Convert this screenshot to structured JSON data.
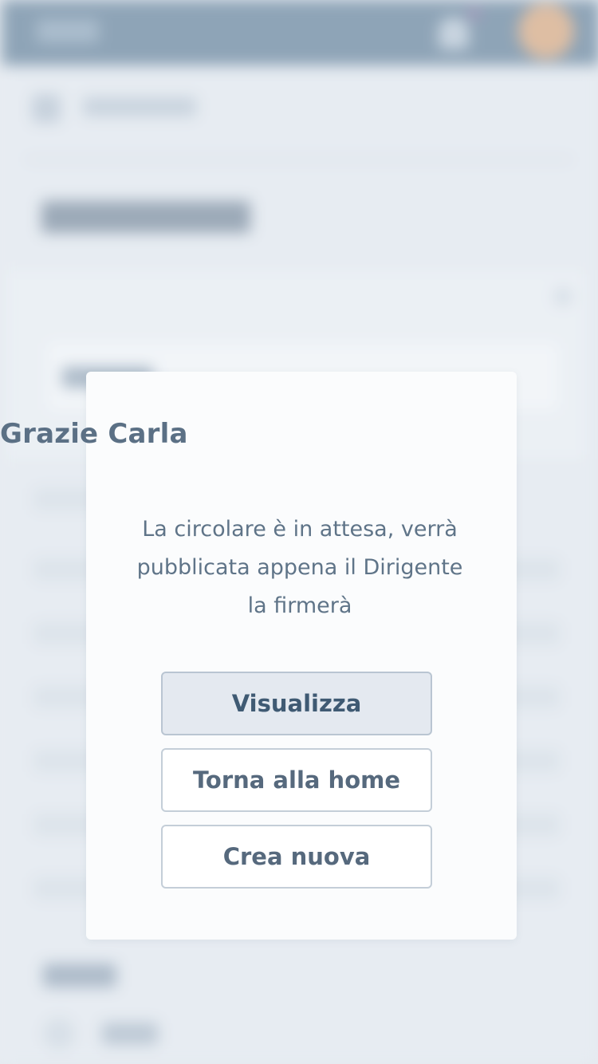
{
  "dialog": {
    "title": "Grazie Carla",
    "message_lines": [
      "La circolare è in attesa, verrà",
      "pubblicata appena il Dirigente",
      "la firmerà"
    ],
    "buttons": {
      "view": "Visualizza",
      "home": "Torna alla home",
      "create_new": "Crea nuova"
    }
  },
  "colors": {
    "topbar": "#5f7d97",
    "title_text": "#5b7085",
    "primary_button_bg": "#e4e9f0",
    "button_border": "#c4ced8"
  },
  "icons": {
    "notification": "bell-icon",
    "profile": "avatar",
    "breadcrumb_home": "home-icon"
  }
}
